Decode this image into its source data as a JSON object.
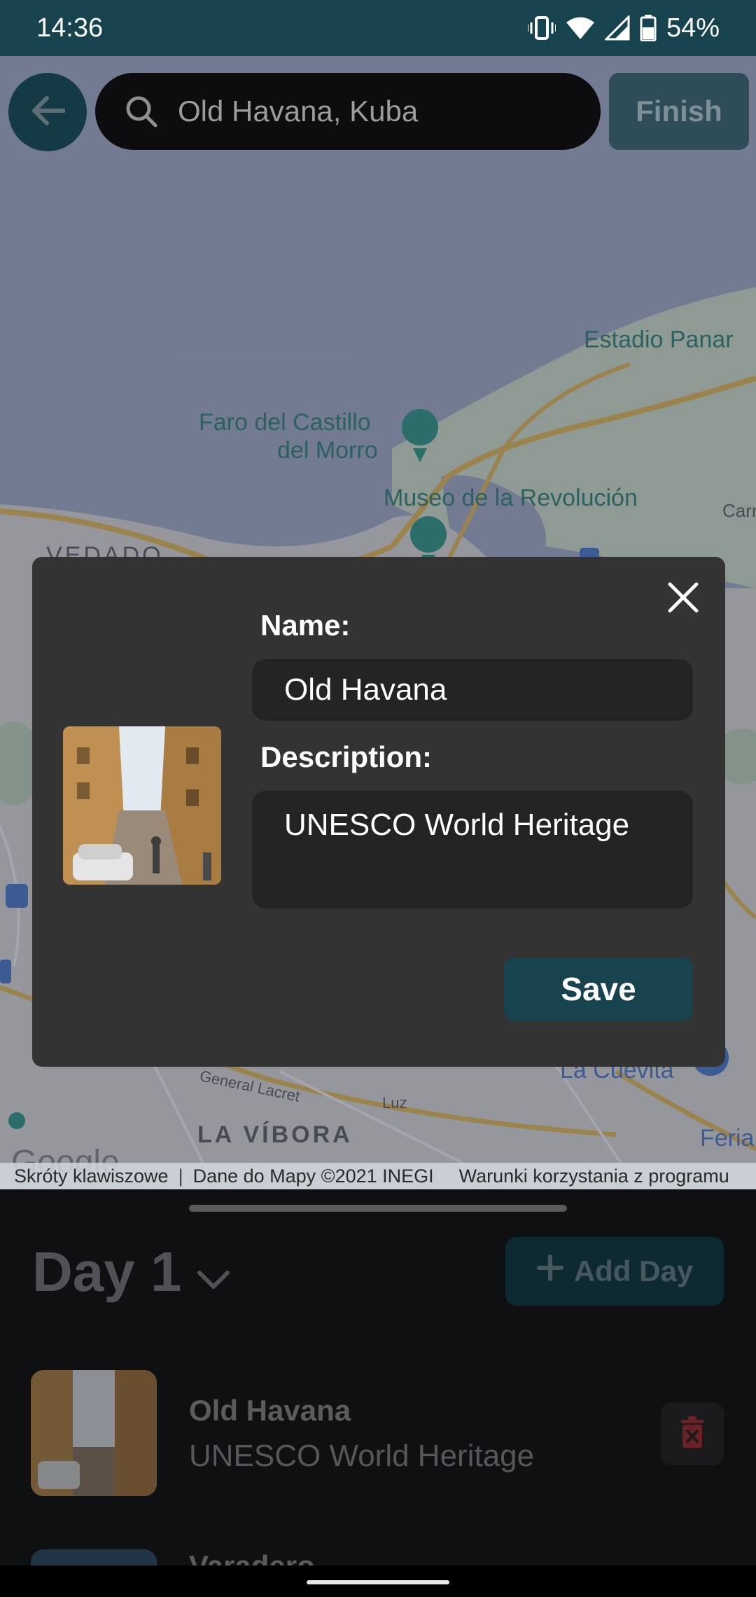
{
  "status_bar": {
    "time": "14:36",
    "battery_percent": "54%",
    "icons": [
      "vibrate-icon",
      "wifi-icon",
      "signal-icon",
      "battery-icon"
    ]
  },
  "header": {
    "search_value": "Old Havana, Kuba",
    "finish_label": "Finish"
  },
  "map": {
    "labels": {
      "estadio": "Estadio Panar",
      "faro_line1": "Faro del Castillo",
      "faro_line2": "del Morro",
      "museo": "Museo de la Revolución",
      "vedado": "VEDADO",
      "carro": "Carre",
      "la_vibora": "LA VÍBORA",
      "la_cuevita": "La Cuevita",
      "feria": "Feria",
      "general_lacret": "General Lacret",
      "luz": "Luz",
      "google": "Google"
    },
    "attribution": {
      "shortcuts": "Skróty klawiszowe",
      "map_data": "Dane do Mapy ©2021 INEGI",
      "terms": "Warunki korzystania z programu"
    }
  },
  "modal": {
    "name_label": "Name:",
    "name_value": "Old Havana",
    "description_label": "Description:",
    "description_value": "UNESCO World Heritage",
    "save_label": "Save"
  },
  "sheet": {
    "day_title": "Day 1",
    "add_day_label": "Add Day",
    "places": [
      {
        "name": "Old Havana",
        "description": "UNESCO World Heritage"
      },
      {
        "name": "Varadero"
      }
    ]
  },
  "colors": {
    "accent": "#17434f",
    "modal_bg": "#333333",
    "input_bg": "#222325",
    "delete_icon": "#6a2226"
  }
}
